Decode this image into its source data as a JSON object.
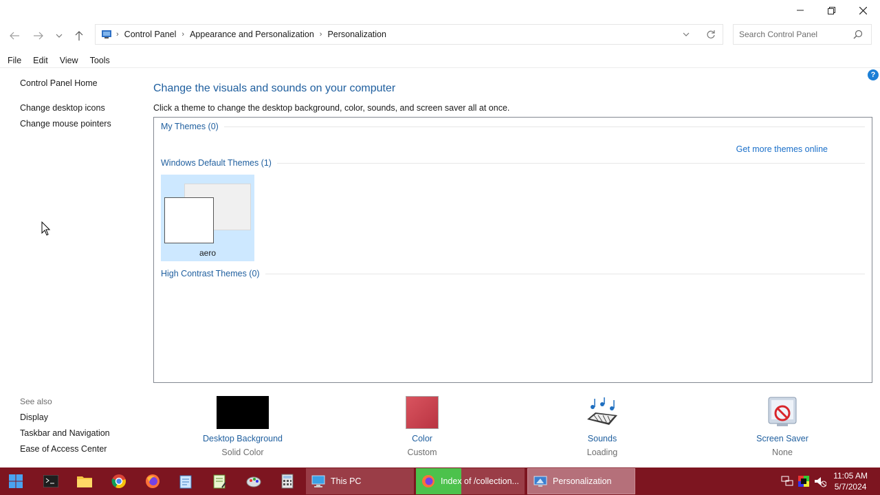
{
  "window": {
    "minimize_icon": "minimize-icon",
    "maximize_icon": "restore-icon",
    "close_icon": "close-icon"
  },
  "address": {
    "breadcrumbs": [
      "Control Panel",
      "Appearance and Personalization",
      "Personalization"
    ],
    "search_placeholder": "Search Control Panel"
  },
  "menu": [
    "File",
    "Edit",
    "View",
    "Tools"
  ],
  "left_pane": {
    "home": "Control Panel Home",
    "links": [
      "Change desktop icons",
      "Change mouse pointers"
    ],
    "see_also_title": "See also",
    "see_also": [
      "Display",
      "Taskbar and Navigation",
      "Ease of Access Center"
    ]
  },
  "main": {
    "heading": "Change the visuals and sounds on your computer",
    "subtitle": "Click a theme to change the desktop background, color, sounds, and screen saver all at once.",
    "groups": {
      "my_themes": "My Themes (0)",
      "get_more": "Get more themes online",
      "windows_default": "Windows Default Themes (1)",
      "high_contrast": "High Contrast Themes (0)"
    },
    "themes": [
      {
        "name": "aero",
        "selected": true
      }
    ]
  },
  "bottom": [
    {
      "label": "Desktop Background",
      "value": "Solid Color",
      "swatch": "#000000"
    },
    {
      "label": "Color",
      "value": "Custom",
      "swatch": "#c8404e"
    },
    {
      "label": "Sounds",
      "value": "Loading",
      "icon": "sounds-icon"
    },
    {
      "label": "Screen Saver",
      "value": "None",
      "icon": "screen-saver-icon"
    }
  ],
  "taskbar": {
    "color": "#7d1520",
    "buttons": [
      {
        "label": "This PC",
        "icon": "this-pc-icon"
      },
      {
        "label": "Index of /collection...",
        "icon": "firefox-icon"
      },
      {
        "label": "Personalization",
        "icon": "personalization-icon"
      }
    ],
    "time": "11:05 AM",
    "date": "5/7/2024"
  }
}
